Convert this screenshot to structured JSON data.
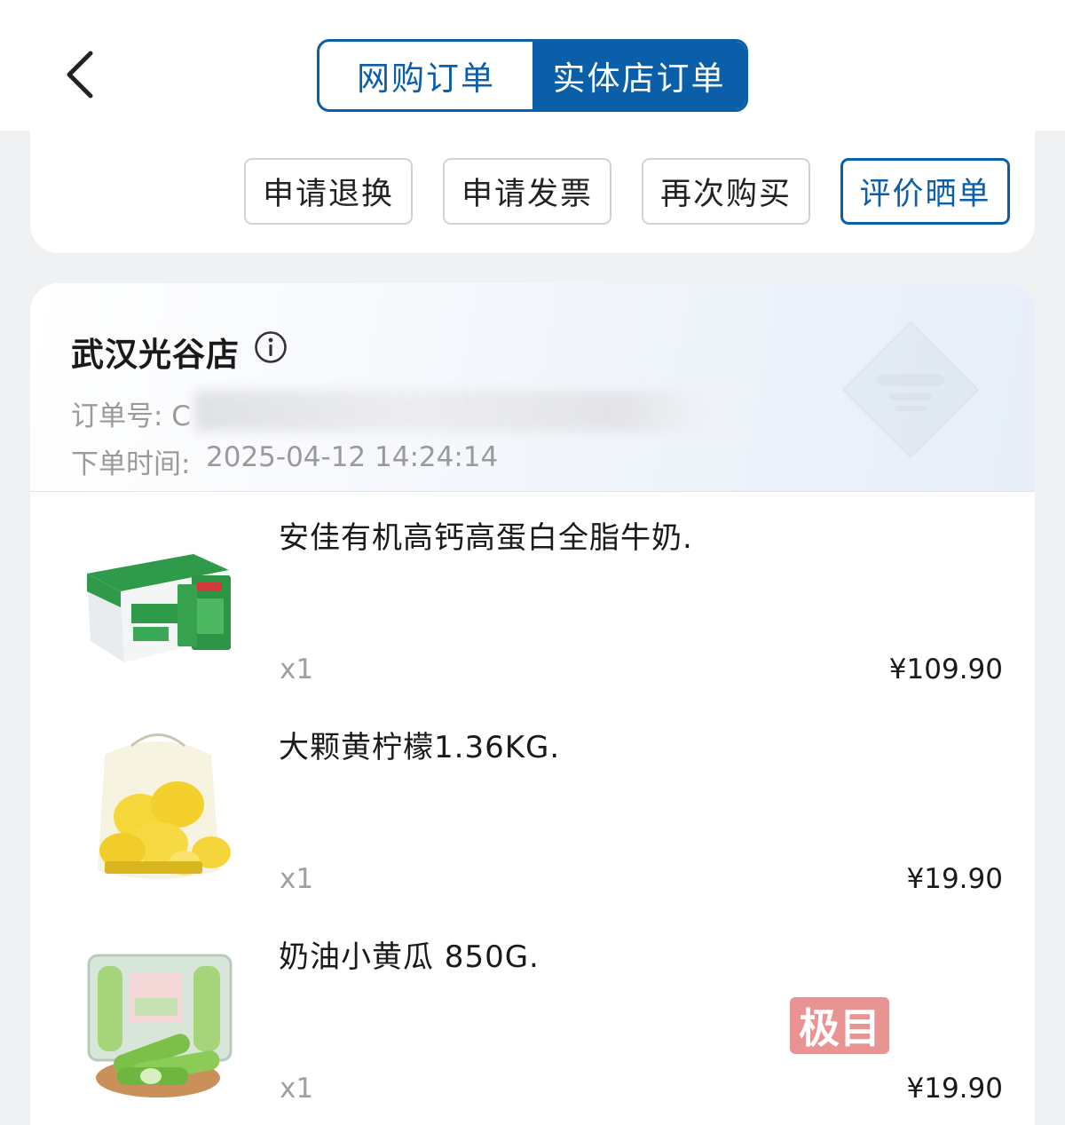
{
  "header": {
    "tabs": [
      {
        "label": "网购订单",
        "active": false
      },
      {
        "label": "实体店订单",
        "active": true
      }
    ]
  },
  "actions": {
    "return_label": "申请退换",
    "invoice_label": "申请发票",
    "rebuy_label": "再次购买",
    "review_label": "评价晒单"
  },
  "order": {
    "store_name": "武汉光谷店",
    "order_no_label": "订单号: C",
    "order_time_label": "下单时间: ",
    "order_time": "2025-04-12 14:24:14",
    "items": [
      {
        "name": "安佳有机高钙高蛋白全脂牛奶.",
        "qty": "x1",
        "price": "¥109.90",
        "image": "milk-box"
      },
      {
        "name": "大颗黄柠檬1.36KG.",
        "qty": "x1",
        "price": "¥19.90",
        "image": "lemon-bag"
      },
      {
        "name": "奶油小黄瓜 850G.",
        "qty": "x1",
        "price": "¥19.90",
        "image": "cucumber-box"
      }
    ]
  },
  "watermark": {
    "text": "极目"
  },
  "colors": {
    "accent": "#0b5ea8",
    "muted_text": "#9a9a9a",
    "background": "#f0f1f3"
  }
}
